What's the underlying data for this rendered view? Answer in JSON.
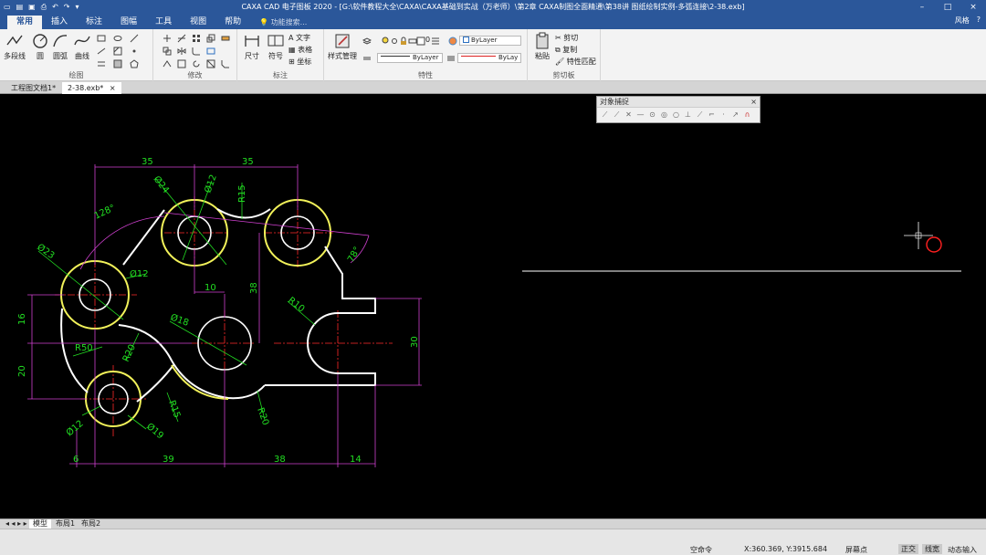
{
  "window": {
    "title": "CAXA CAD 电子图板 2020 - [G:\\软件教程大全\\CAXA\\CAXA基础到实战（万老师）\\第2章 CAXA制图全面精通\\第38讲 图纸绘制实例-多弧连接\\2-38.exb]",
    "minimize": "–",
    "maximize": "□",
    "close": "×"
  },
  "menu": {
    "tabs": [
      "常用",
      "插入",
      "标注",
      "图幅",
      "工具",
      "视图",
      "帮助"
    ],
    "search_placeholder": "功能搜索...",
    "style_label": "风格",
    "help": "?"
  },
  "ribbon": {
    "draw_group": "绘图",
    "modify_group": "修改",
    "annotate_group": "标注",
    "property_group": "特性",
    "clipboard_group": "剪切板",
    "polyline": "多段线",
    "circle": "圆",
    "arc": "圆弧",
    "curve": "曲线",
    "dimension": "尺寸",
    "symbol": "符号",
    "text": "文字",
    "table": "表格",
    "coordinate": "坐标",
    "style_manager": "样式管理",
    "bylayer_layer": "ByLayer",
    "bylayer_line": "ByLayer",
    "bylayer_color": "ByLay",
    "layer_num": "0",
    "paste": "粘贴",
    "cut": "剪切",
    "copy": "复制",
    "match": "特性匹配"
  },
  "doc_tabs": [
    {
      "label": "工程图文档1*",
      "active": false
    },
    {
      "label": "2-38.exb*",
      "active": true
    }
  ],
  "doc_tab_close": "×",
  "snap_panel": {
    "title": "对象捕捉",
    "close": "×"
  },
  "drawing": {
    "dims": {
      "d35a": "35",
      "d35b": "35",
      "d24": "Ø24",
      "d12a": "Ø12",
      "r15a": "R15",
      "a128": "128°",
      "d23": "Ø23",
      "d12b": "Ø12",
      "a78": "78°",
      "d10": "10",
      "d38v": "38",
      "r10": "R10",
      "d18": "Ø18",
      "d16": "16",
      "r50": "R50",
      "r20a": "R20",
      "d20": "20",
      "d30": "30",
      "r15b": "R15",
      "r20b": "R20",
      "d12c": "Ø12",
      "d19": "Ø19",
      "d6": "6",
      "d39": "39",
      "d38h": "38",
      "d14": "14"
    },
    "colors": {
      "outline": "#ffffff",
      "bosses": "#f2f25a",
      "dimension": "#d040d0",
      "dim_text": "#22dd22",
      "center": "#ff2a2a",
      "cursor_circle": "#ff2020"
    }
  },
  "layout_tabs": [
    {
      "label": "模型",
      "active": true
    },
    {
      "label": "布局1",
      "active": false
    },
    {
      "label": "布局2",
      "active": false
    }
  ],
  "nav_arrows": "◂ ◂ ▸ ▸",
  "status": {
    "command": "空命令",
    "coords": "X:360.369, Y:3915.684",
    "snap_mode": "屏幕点",
    "ortho": "正交",
    "lineweight": "线宽",
    "dynamic_input": "动态输入"
  }
}
